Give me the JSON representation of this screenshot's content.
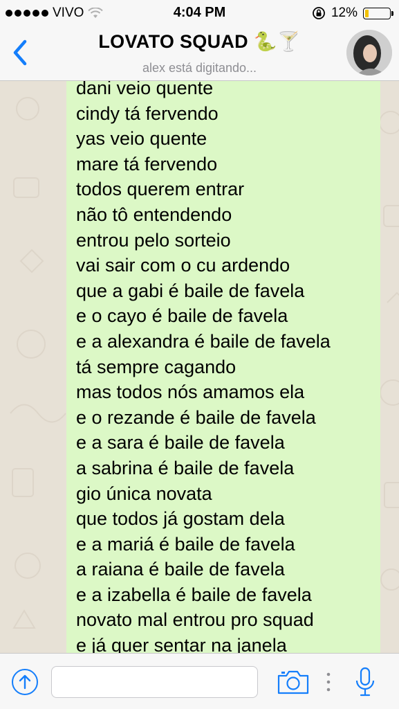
{
  "status_bar": {
    "carrier": "VIVO",
    "time": "4:04 PM",
    "battery_percent": "12%",
    "battery_level": 0.12,
    "icons": [
      "signal-dots-icon",
      "wifi-icon",
      "orientation-lock-icon",
      "battery-icon"
    ]
  },
  "header": {
    "title": "LOVATO SQUAD 🐍🍸",
    "subtitle": "alex está digitando...",
    "back_icon": "chevron-left-icon",
    "accent_color": "#147efb"
  },
  "message": {
    "bubble_color": "#dcf8c6",
    "lines": [
      "dani veio quente",
      "cindy tá fervendo",
      "yas veio quente",
      "mare tá fervendo",
      "todos querem entrar",
      "não tô entendendo",
      "entrou pelo sorteio",
      "vai sair com o cu ardendo",
      "que a gabi é baile de favela",
      "e o cayo é baile de favela",
      "e a alexandra é baile de favela",
      "tá sempre cagando",
      "mas todos nós amamos ela",
      "e o rezande é baile de favela",
      "e a sara é baile de favela",
      "a sabrina é baile de favela",
      "gio única novata",
      "que todos já gostam dela",
      "e a mariá é baile de favela",
      "a raiana é baile de favela",
      "e a izabella é baile de favela",
      "novato mal entrou pro squad",
      "e já quer sentar na janela"
    ]
  },
  "input_bar": {
    "text_value": "",
    "icons": [
      "upload-icon",
      "camera-icon",
      "more-icon",
      "microphone-icon"
    ]
  }
}
